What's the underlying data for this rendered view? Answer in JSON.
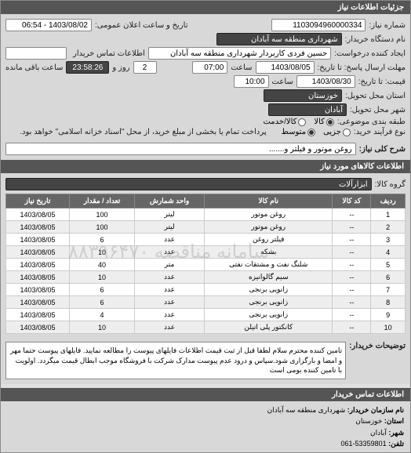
{
  "sections": {
    "needInfoHeader": "جزئیات اطلاعات نیاز",
    "itemsHeader": "اطلاعات کالاهای مورد نیاز",
    "contactHeader": "اطلاعات تماس خریدار"
  },
  "labels": {
    "requestNumber": "شماره نیاز:",
    "publicAnnounce": "تاریخ و ساعت اعلان عمومی:",
    "buyerName": "نام دستگاه خریدار:",
    "requester": "ایجاد کننده درخواست:",
    "buyerContact": "اطلاعات تماس خریدار",
    "deadlineSend": "مهلت ارسال پاسخ: تا تاریخ:",
    "deadlineTime": "ساعت",
    "remaining1": "روز و",
    "remaining2": "ساعت باقی مانده",
    "quoteDeadline": "قیمت: تا تاریخ:",
    "deliveryProvince": "استان محل تحویل:",
    "deliveryCity": "شهر محل تحویل:",
    "budgetType": "طبقه بندی موضوعی:",
    "processType": "نوع فرآیند خرید:",
    "processNote": "پرداخت تمام یا بخشی از مبلغ خرید، از محل \"اسناد خزانه اسلامی\" خواهد بود.",
    "needTitle": "شرح کلی نیاز:",
    "itemGroup": "گروه کالا:",
    "notesLabel": "توضیحات خریدار:",
    "orgName": "نام سازمان خریدار:",
    "province": "استان:",
    "city": "شهر:",
    "phone": "تلفن:"
  },
  "values": {
    "requestNumber": "1103094960000334",
    "publicAnnounceDate": "1403/08/02 - 06:54",
    "buyerName": "شهرداری منطقه سه آبادان",
    "requester": "حسین فردی کاربردار شهرداری منطقه سه آبادان",
    "buyerContact": "",
    "deadlineDate": "1403/08/05",
    "deadlineTime": "07:00",
    "remainingDays": "2",
    "remainingTime": "23:58:26",
    "quoteDate": "1403/08/30",
    "quoteTime": "10:00",
    "deliveryProvince": "خوزستان",
    "deliveryCity": "آبادان",
    "needTitle": "روغن موتور و فیلتر و.......",
    "itemGroup": "ابزارآلات",
    "notes": "تامین کننده محترم سلام لطفا قبل از ثبت قیمت اطلاعات فایلهای پیوست را مطالعه نمایید. فایلهای پیوست حتما مهر و امضا و بارگزاری شود.سپاس و درود عدم پیوست مدارک شرکت با فروشگاه موجب ابطال قیمت میگردد. اولویت با تامین کننده بومی است",
    "contactOrg": "شهرداری منطقه سه آبادان",
    "contactProvince": "خوزستان",
    "contactCity": "آبادان",
    "contactPhone": "53359801-061"
  },
  "radios": {
    "budget": [
      {
        "label": "کالا",
        "checked": true
      },
      {
        "label": "کالا/خدمت",
        "checked": false
      }
    ],
    "process": [
      {
        "label": "جزیی",
        "checked": false
      },
      {
        "label": "متوسط",
        "checked": true
      }
    ]
  },
  "table": {
    "headers": [
      "ردیف",
      "کد کالا",
      "نام کالا",
      "واحد شمارش",
      "تعداد / مقدار",
      "تاریخ نیاز"
    ],
    "rows": [
      [
        "1",
        "--",
        "روغن موتور",
        "لیتر",
        "100",
        "1403/08/05"
      ],
      [
        "2",
        "--",
        "روغن موتور",
        "لیتر",
        "100",
        "1403/08/05"
      ],
      [
        "3",
        "--",
        "فیلتر روغن",
        "عدد",
        "6",
        "1403/08/05"
      ],
      [
        "4",
        "--",
        "بشکه",
        "عدد",
        "10",
        "1403/08/05"
      ],
      [
        "5",
        "--",
        "شلنگ نفت و مشتقات نفتی",
        "متر",
        "40",
        "1403/08/05"
      ],
      [
        "6",
        "--",
        "سیم گالوانیزه",
        "عدد",
        "10",
        "1403/08/05"
      ],
      [
        "7",
        "--",
        "زانویی برنجی",
        "عدد",
        "6",
        "1403/08/05"
      ],
      [
        "8",
        "--",
        "زانویی برنجی",
        "عدد",
        "6",
        "1403/08/05"
      ],
      [
        "9",
        "--",
        "زانویی برنجی",
        "عدد",
        "4",
        "1403/08/05"
      ],
      [
        "10",
        "--",
        "کانکتور پلی اتیلن",
        "عدد",
        "10",
        "1403/08/05"
      ]
    ]
  },
  "watermark": "سامانه مناقصه ۸۸۳۹۶۴۷۰"
}
